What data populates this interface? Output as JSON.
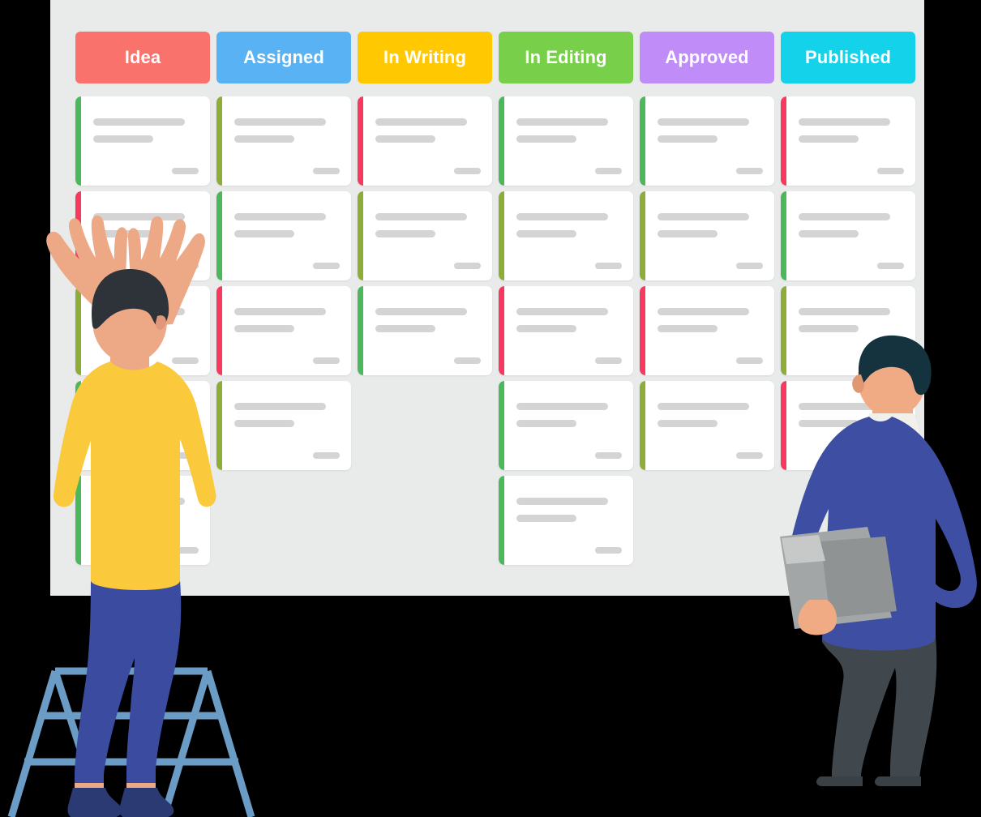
{
  "scene": {
    "title": "Editorial content kanban board illustration",
    "board_background": "#e9eaea",
    "page_background": "#000000",
    "card_background": "#ffffff",
    "placeholder_line_color": "#d4d4d4"
  },
  "board": {
    "columns": [
      {
        "id": "idea",
        "label": "Idea",
        "color": "#f9736c"
      },
      {
        "id": "assigned",
        "label": "Assigned",
        "color": "#59b2f4"
      },
      {
        "id": "in-writing",
        "label": "In Writing",
        "color": "#ffc800"
      },
      {
        "id": "in-editing",
        "label": "In Editing",
        "color": "#77cf4a"
      },
      {
        "id": "approved",
        "label": "Approved",
        "color": "#c08cf7"
      },
      {
        "id": "published",
        "label": "Published",
        "color": "#13d2ea"
      }
    ],
    "accent_palette": {
      "green": "#4cb85c",
      "olive": "#8ead38",
      "pink": "#f7385f"
    },
    "rows": [
      {
        "index": 1,
        "cards": [
          {
            "column": "idea",
            "accent": "green"
          },
          {
            "column": "assigned",
            "accent": "olive"
          },
          {
            "column": "in-writing",
            "accent": "pink"
          },
          {
            "column": "in-editing",
            "accent": "green"
          },
          {
            "column": "approved",
            "accent": "green"
          },
          {
            "column": "published",
            "accent": "pink"
          }
        ]
      },
      {
        "index": 2,
        "cards": [
          {
            "column": "idea",
            "accent": "pink"
          },
          {
            "column": "assigned",
            "accent": "green"
          },
          {
            "column": "in-writing",
            "accent": "olive"
          },
          {
            "column": "in-editing",
            "accent": "olive"
          },
          {
            "column": "approved",
            "accent": "olive"
          },
          {
            "column": "published",
            "accent": "green"
          }
        ]
      },
      {
        "index": 3,
        "cards": [
          {
            "column": "idea",
            "accent": "olive"
          },
          {
            "column": "assigned",
            "accent": "pink"
          },
          {
            "column": "in-writing",
            "accent": "green"
          },
          {
            "column": "in-editing",
            "accent": "pink"
          },
          {
            "column": "approved",
            "accent": "pink"
          },
          {
            "column": "published",
            "accent": "olive"
          }
        ]
      },
      {
        "index": 4,
        "cards": [
          {
            "column": "idea",
            "accent": "green"
          },
          {
            "column": "assigned",
            "accent": "olive"
          },
          {
            "column": "in-editing",
            "accent": "green"
          },
          {
            "column": "approved",
            "accent": "olive"
          },
          {
            "column": "published",
            "accent": "pink"
          }
        ]
      },
      {
        "index": 5,
        "cards": [
          {
            "column": "idea",
            "accent": "green"
          },
          {
            "column": "in-editing",
            "accent": "green"
          }
        ]
      }
    ],
    "card_counts_by_column": {
      "idea": 5,
      "assigned": 4,
      "in-writing": 3,
      "in-editing": 5,
      "approved": 4,
      "published": 4
    }
  },
  "people": {
    "left": {
      "name": "man-on-stepladder",
      "description": "Man standing on a blue A-frame stepladder, arms raised toward the board, seen from behind",
      "shirt_color": "#fbc93c",
      "trousers_color": "#3a4ba0",
      "shoe_color": "#2c3a74",
      "skin_color": "#eda886",
      "hair_color": "#2e333a",
      "watch_color": "#c94b4b",
      "ladder_color": "#6b9cc5"
    },
    "right": {
      "name": "man-with-folder",
      "description": "Man standing with one hand on his hip, holding a grey folder, looking at the board, seen from behind",
      "sweater_color": "#3d4ea3",
      "trousers_color": "#41484d",
      "shoe_color": "#3a4146",
      "skin_color": "#f0ab84",
      "hair_color": "#14333f",
      "collar_color": "#f2f0ea",
      "folder_colors": [
        "#a3a6a6",
        "#8f9393",
        "#c7c9c9"
      ]
    }
  }
}
